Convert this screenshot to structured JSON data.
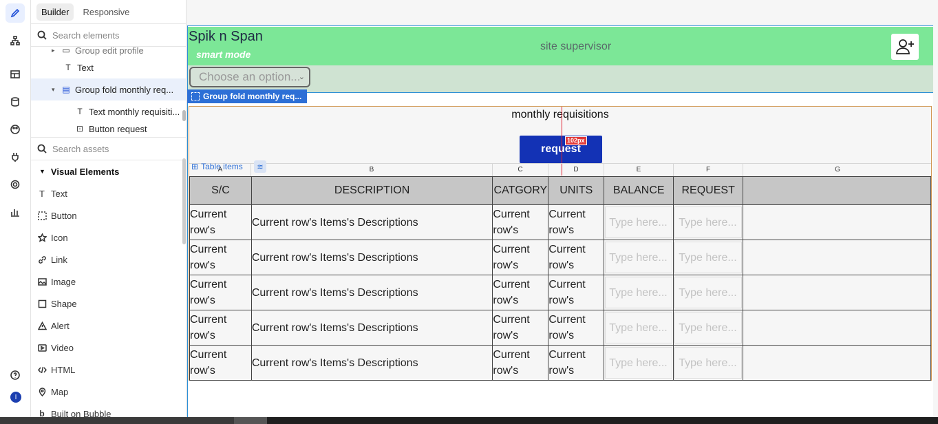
{
  "editor": {
    "tabs": [
      "Builder",
      "Responsive"
    ],
    "search_elements_placeholder": "Search elements",
    "search_assets_placeholder": "Search assets",
    "tree": [
      {
        "label": "Group edit profile",
        "icon": "group-icon"
      },
      {
        "label": "Text",
        "icon": "text-icon"
      },
      {
        "label": "Group fold monthly req...",
        "icon": "group-icon"
      },
      {
        "label": "Text monthly requisiti...",
        "icon": "text-icon"
      },
      {
        "label": "Button request",
        "icon": "button-icon"
      }
    ],
    "category": "Visual Elements",
    "elements": [
      {
        "label": "Text",
        "icon": "text-icon"
      },
      {
        "label": "Button",
        "icon": "button-icon"
      },
      {
        "label": "Icon",
        "icon": "star-icon"
      },
      {
        "label": "Link",
        "icon": "link-icon"
      },
      {
        "label": "Image",
        "icon": "image-icon"
      },
      {
        "label": "Shape",
        "icon": "square-icon"
      },
      {
        "label": "Alert",
        "icon": "alert-icon"
      },
      {
        "label": "Video",
        "icon": "video-icon"
      },
      {
        "label": "HTML",
        "icon": "code-icon"
      },
      {
        "label": "Map",
        "icon": "map-pin-icon"
      },
      {
        "label": "Built on Bubble",
        "icon": "bubble-logo-icon"
      }
    ],
    "avatar_initial": "I",
    "selection_badge": "Group fold monthly req...",
    "guide_badge": "102px",
    "table_label": "Table items"
  },
  "app": {
    "brand": "Spik n Span",
    "mode": "smart mode",
    "role": "site supervisor",
    "dropdown_placeholder": "Choose an option...",
    "group_title": "monthly requisitions",
    "request_button": "request",
    "column_letters": [
      "A",
      "B",
      "C",
      "D",
      "E",
      "F",
      "G"
    ],
    "table": {
      "headers": [
        "S/C",
        "DESCRIPTION",
        "CATGORY",
        "UNITS",
        "BALANCE",
        "REQUEST"
      ],
      "rows": [
        {
          "sc": "Current row's",
          "description": "Current row's Items's Descriptions",
          "category": "Current row's",
          "units": "Current row's",
          "balance": "Type here...",
          "request": "Type here..."
        },
        {
          "sc": "Current row's",
          "description": "Current row's Items's Descriptions",
          "category": "Current row's",
          "units": "Current row's",
          "balance": "Type here...",
          "request": "Type here..."
        },
        {
          "sc": "Current row's",
          "description": "Current row's Items's Descriptions",
          "category": "Current row's",
          "units": "Current row's",
          "balance": "Type here...",
          "request": "Type here..."
        },
        {
          "sc": "Current row's",
          "description": "Current row's Items's Descriptions",
          "category": "Current row's",
          "units": "Current row's",
          "balance": "Type here...",
          "request": "Type here..."
        },
        {
          "sc": "Current row's",
          "description": "Current row's Items's Descriptions",
          "category": "Current row's",
          "units": "Current row's",
          "balance": "Type here...",
          "request": "Type here..."
        }
      ]
    }
  },
  "colors": {
    "header_green": "#7ce797",
    "filter_bar": "#cfe3d2",
    "button_blue": "#1332b5",
    "selection_blue": "#2d6fd6",
    "guide_red": "#e0212f"
  }
}
